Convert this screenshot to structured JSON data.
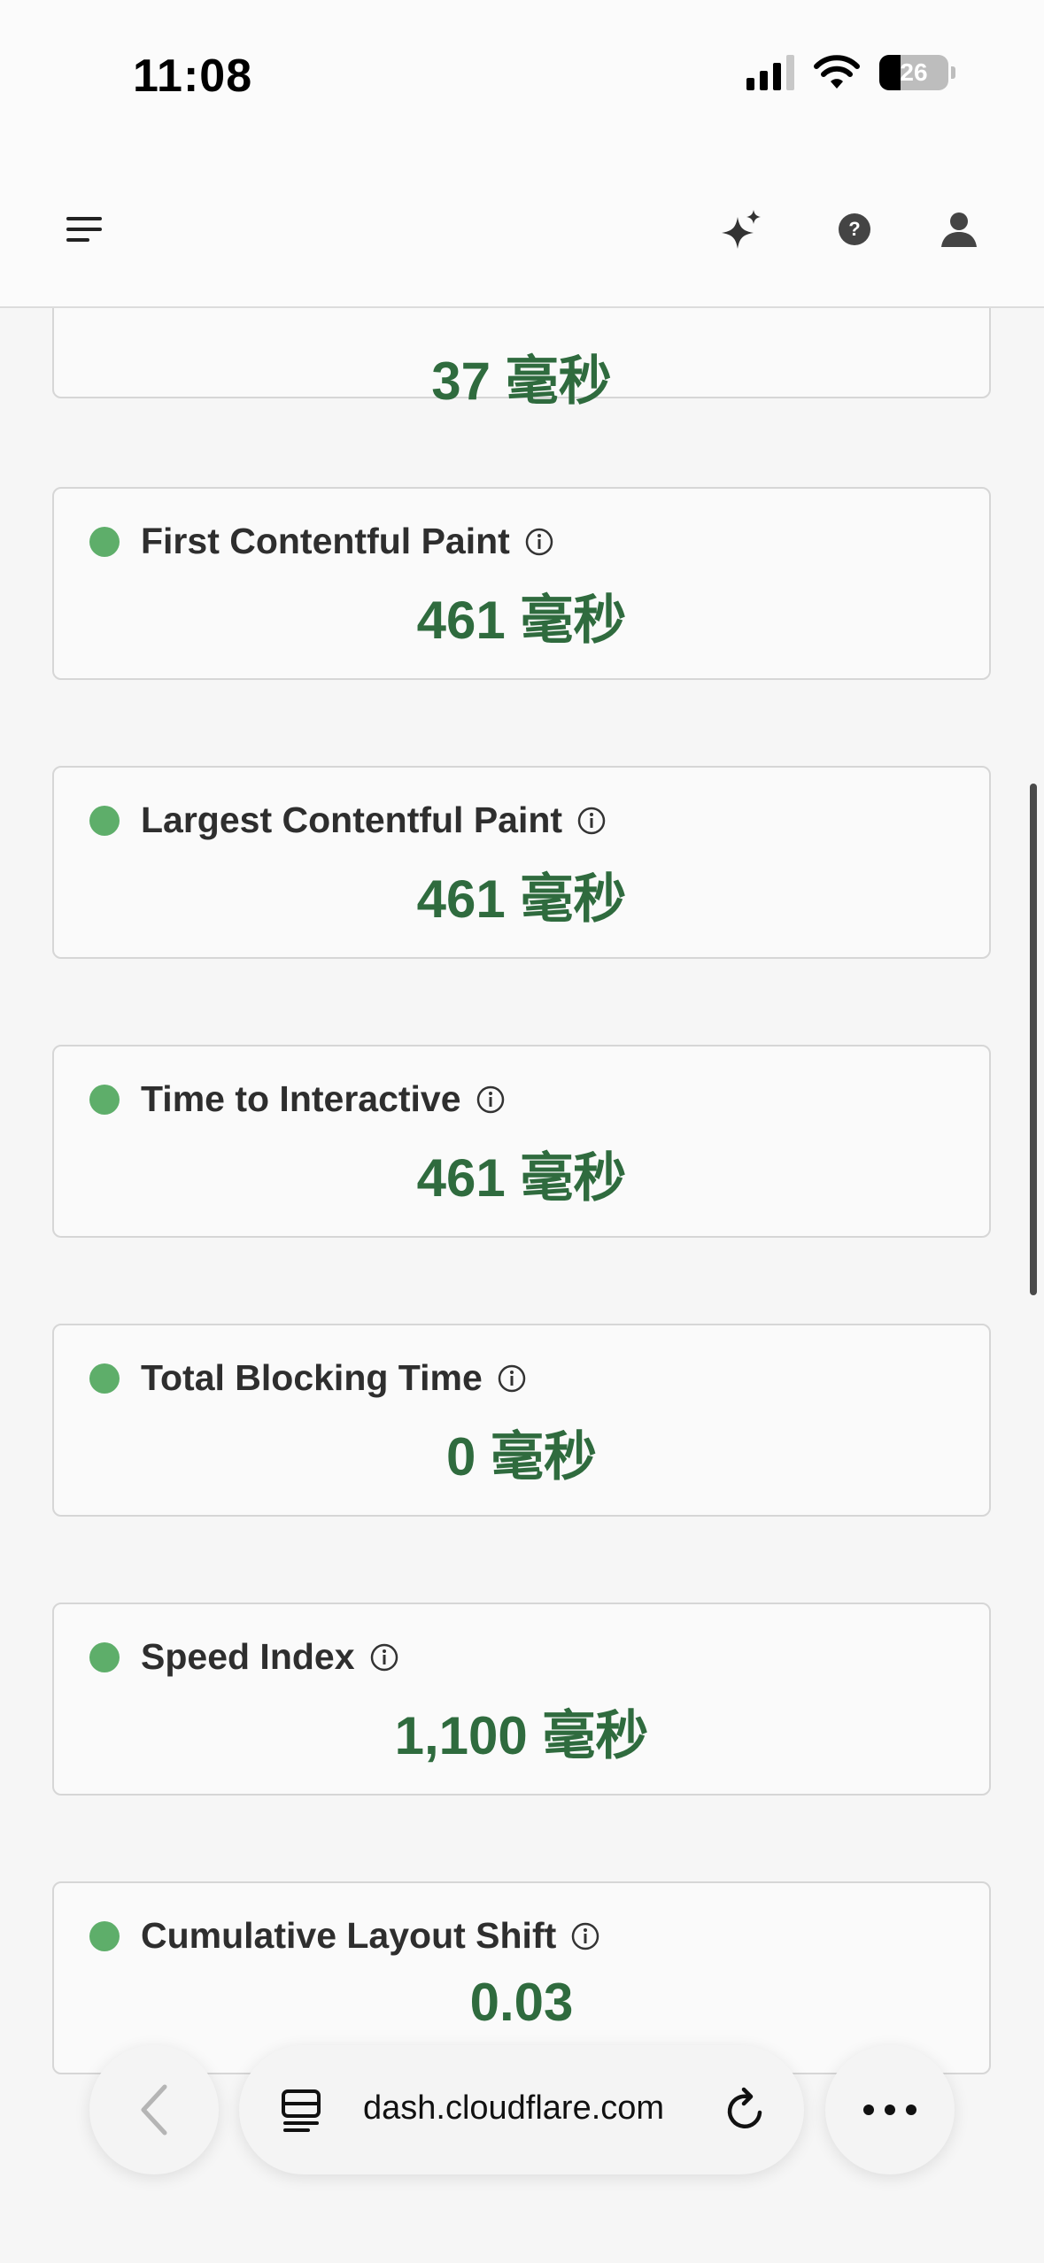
{
  "status_bar": {
    "time": "11:08",
    "battery": "26"
  },
  "header": {
    "menu_icon": "menu-icon",
    "ai_icon": "sparkle-icon",
    "help_icon": "help-icon",
    "account_icon": "user-icon"
  },
  "metrics": [
    {
      "label": "",
      "value": "37 毫秒"
    },
    {
      "label": "First Contentful Paint",
      "value": "461 毫秒"
    },
    {
      "label": "Largest Contentful Paint",
      "value": "461 毫秒"
    },
    {
      "label": "Time to Interactive",
      "value": "461 毫秒"
    },
    {
      "label": "Total Blocking Time",
      "value": "0 毫秒"
    },
    {
      "label": "Speed Index",
      "value": "1,100 毫秒"
    },
    {
      "label": "Cumulative Layout Shift",
      "value": "0.03"
    }
  ],
  "colors": {
    "good": "#5eae6a",
    "value_text": "#2f6b3e"
  },
  "browser": {
    "url": "dash.cloudflare.com"
  }
}
